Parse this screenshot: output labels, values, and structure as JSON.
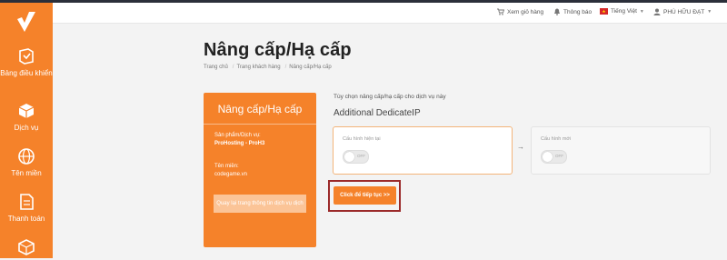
{
  "topbar": {
    "cart": "Xem giỏ hàng",
    "notifications": "Thông báo",
    "language": "Tiếng Việt",
    "user": "PHÙ HỮU ĐẠT"
  },
  "sidebar": {
    "items": [
      {
        "label": "Bảng điều khiển",
        "icon": "dashboard-icon"
      },
      {
        "label": "Dịch vụ",
        "icon": "box-icon"
      },
      {
        "label": "Tên miền",
        "icon": "globe-icon"
      },
      {
        "label": "Thanh toán",
        "icon": "document-icon"
      },
      {
        "label": "",
        "icon": "box-icon"
      }
    ]
  },
  "page": {
    "title": "Nâng cấp/Hạ cấp",
    "breadcrumbs": [
      "Trang chủ",
      "Trang khách hàng",
      "Nâng cấp/Hạ cấp"
    ]
  },
  "card": {
    "title": "Nâng cấp/Hạ cấp",
    "product_label": "Sản phẩm/Dịch vụ:",
    "product_value": "ProHosting - ProH3",
    "domain_label": "Tên miền:",
    "domain_value": "codegame.vn",
    "back_button": "Quay lại trang thông tin dịch vụ dịch"
  },
  "main": {
    "intro": "Tùy chọn nâng cấp/hạ cấp cho dịch vụ này",
    "service_name": "Additional DedicateIP",
    "current_label": "Cấu hình hiện tại",
    "new_label": "Cấu hình mới",
    "toggle_text": "OFF",
    "arrow": "→",
    "continue_button": "Click để tiếp tục >>"
  },
  "colors": {
    "accent": "#f5822a",
    "highlight": "#9b2a2a"
  }
}
